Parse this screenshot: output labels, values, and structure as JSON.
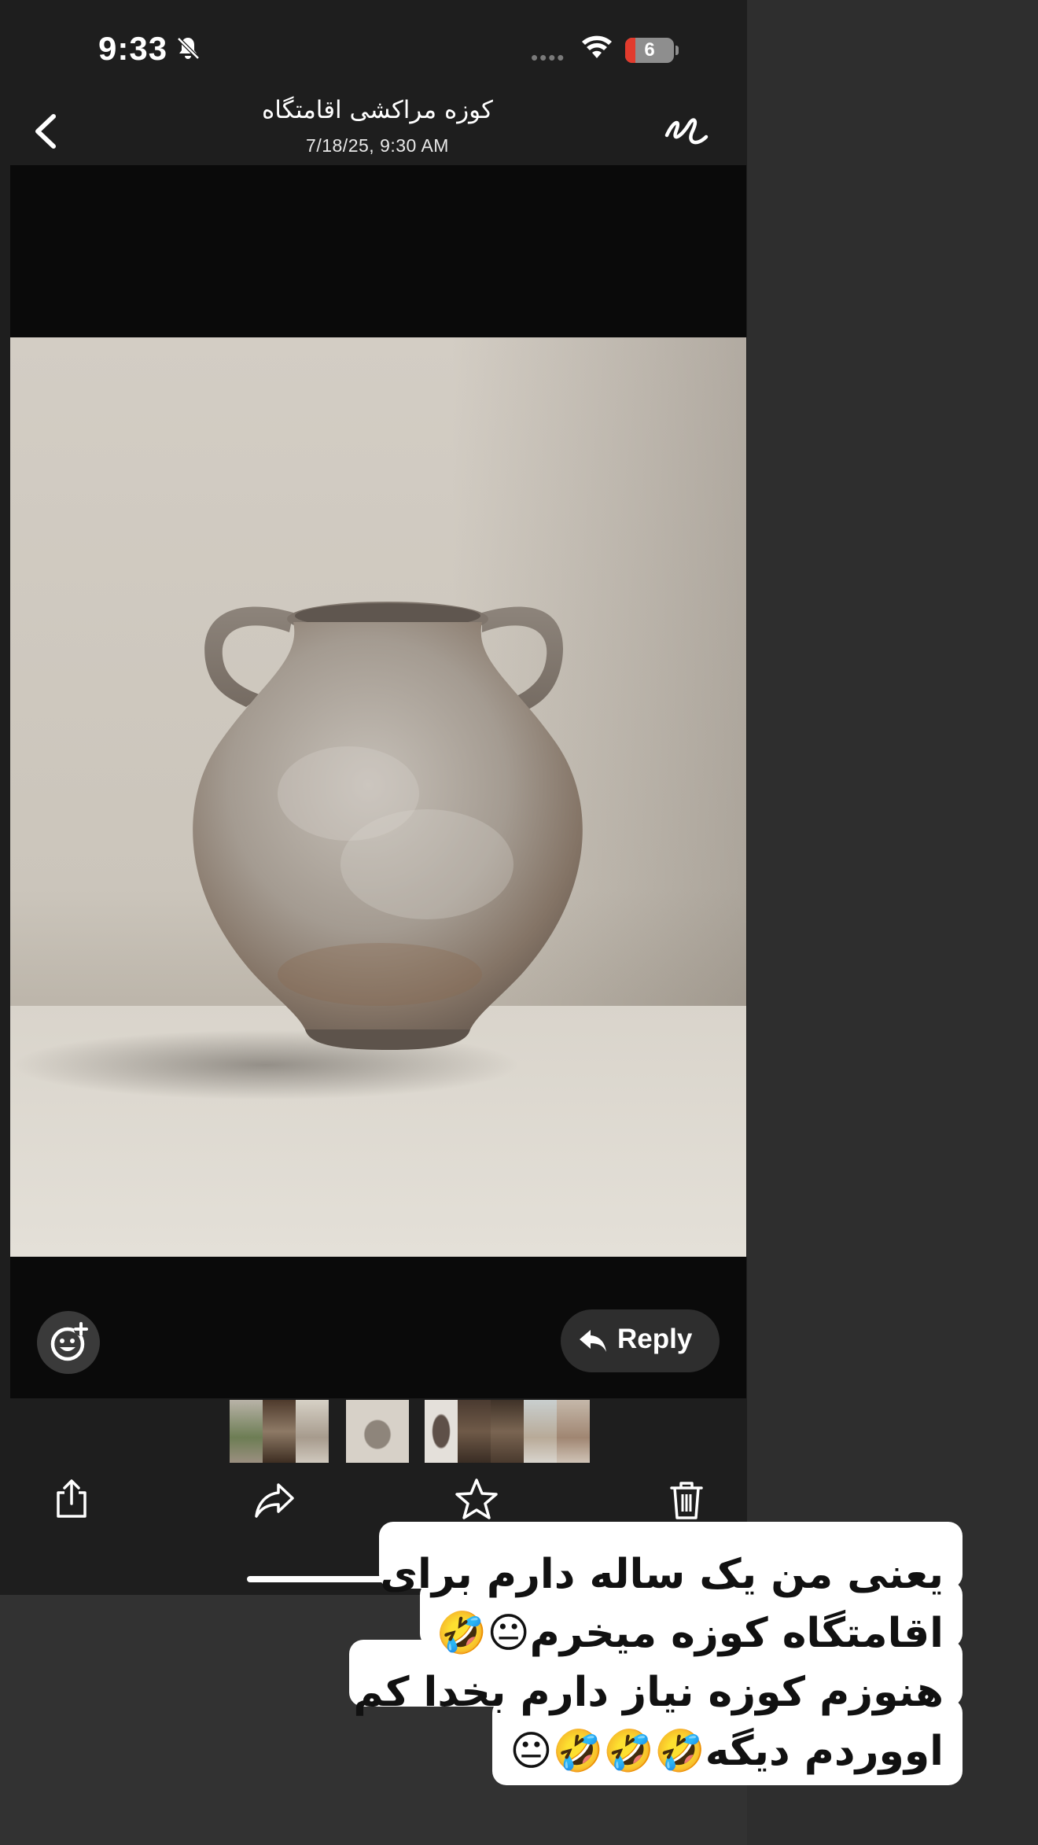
{
  "status_bar": {
    "time": "9:33",
    "battery_level": "6",
    "signal_dots": "••••"
  },
  "header": {
    "title": "کوزه مراکشی اقامتگاه",
    "subtitle": "7/18/25, 9:30 AM"
  },
  "viewer": {
    "reply_label": "Reply"
  },
  "caption": {
    "lines": [
      "یعنی من یک ساله دارم برای",
      "اقامتگاه کوزه میخرم😐🤣",
      "هنوزم کوزه نیاز دارم بخدا کم",
      "اووردم دیگه🤣🤣🤣😐"
    ]
  },
  "toolbar": {
    "icons": [
      "share-icon",
      "forward-icon",
      "star-icon",
      "trash-icon"
    ]
  },
  "colors": {
    "panel_bg": "#1e1e1e",
    "right_bg": "#2e2e2e",
    "battery_red": "#e23b2d",
    "caption_bg": "#ffffff"
  }
}
